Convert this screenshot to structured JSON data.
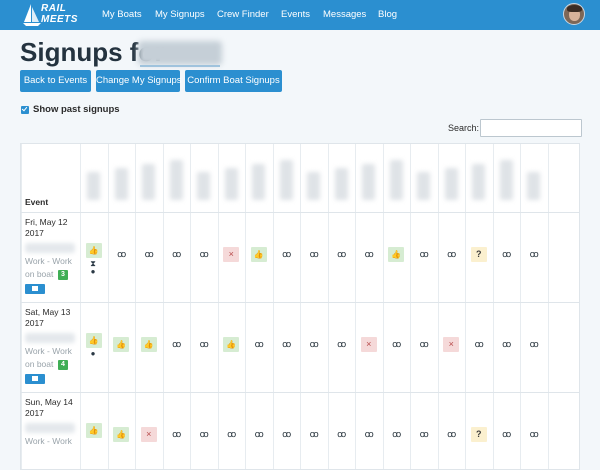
{
  "brand": {
    "line1": "RAIL",
    "line2": "MEETS"
  },
  "nav": [
    {
      "label": "My Boats"
    },
    {
      "label": "My Signups"
    },
    {
      "label": "Crew Finder"
    },
    {
      "label": "Events"
    },
    {
      "label": "Messages"
    },
    {
      "label": "Blog"
    }
  ],
  "title": "Signups for",
  "buttons": {
    "back": "Back to Events",
    "change": "Change My Signups",
    "confirm": "Confirm Boat Signups"
  },
  "show_past": {
    "label": "Show past signups",
    "checked": true
  },
  "search": {
    "label": "Search:",
    "value": "",
    "placeholder": ""
  },
  "table": {
    "event_header": "Event",
    "rows": [
      {
        "date1": "Fri, May 12",
        "date2": "2017",
        "work1": "Work - Work",
        "work2": "on boat",
        "count": "3",
        "statuses": [
          "yes",
          "none",
          "none",
          "none",
          "none",
          "no",
          "yes",
          "none",
          "none",
          "none",
          "none",
          "yes",
          "none",
          "none",
          "maybe",
          "none",
          "none"
        ],
        "sub_icons": [
          "hourglass-icon",
          "helmet-icon"
        ]
      },
      {
        "date1": "Sat, May 13",
        "date2": "2017",
        "work1": "Work - Work",
        "work2": "on boat",
        "count": "4",
        "statuses": [
          "yes",
          "yes",
          "yes",
          "none",
          "none",
          "yes",
          "none",
          "none",
          "none",
          "none",
          "no",
          "none",
          "none",
          "no",
          "none",
          "none",
          "none"
        ],
        "sub_icons": [
          "helmet-icon"
        ]
      },
      {
        "date1": "Sun, May 14",
        "date2": "2017",
        "work1": "Work - Work",
        "work2": "",
        "count": "",
        "statuses": [
          "yes",
          "yes",
          "no",
          "none",
          "none",
          "none",
          "none",
          "none",
          "none",
          "none",
          "none",
          "none",
          "none",
          "none",
          "maybe",
          "none",
          "none"
        ],
        "sub_icons": []
      }
    ]
  },
  "status_glyphs": {
    "yes": "👍",
    "no": "×",
    "maybe": "?",
    "none": "ꝏ"
  },
  "colors": {
    "primary": "#2b8fd0",
    "yes_bg": "#d6ecd2",
    "no_bg": "#f5d9d9",
    "maybe_bg": "#fbf0cf"
  }
}
